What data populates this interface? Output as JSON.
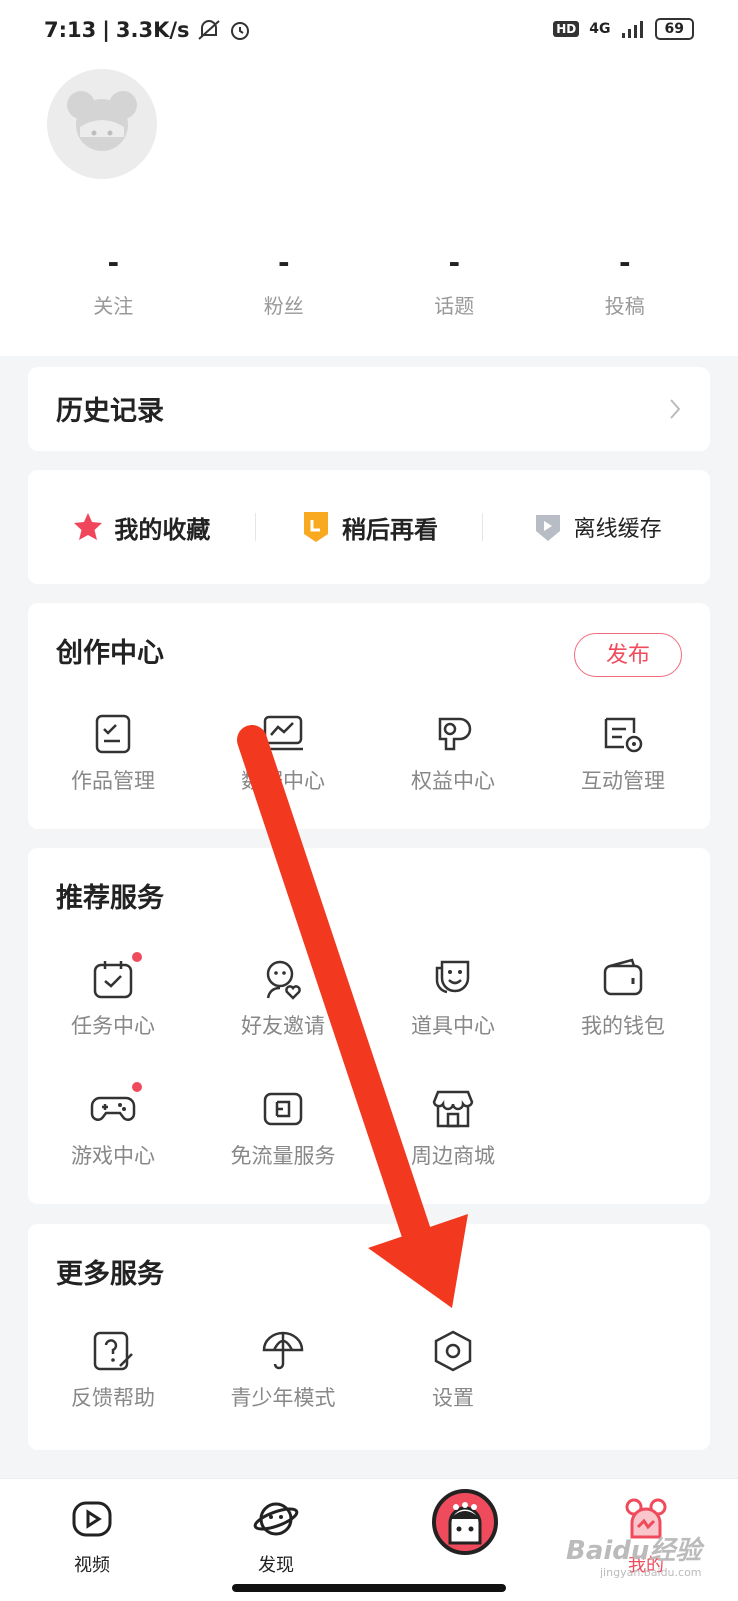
{
  "status": {
    "time": "7:13",
    "speed": "3.3K/s",
    "network": "4G",
    "hd": "HD",
    "battery": "69"
  },
  "profile": {
    "stats": [
      {
        "value": "-",
        "label": "关注"
      },
      {
        "value": "-",
        "label": "粉丝"
      },
      {
        "value": "-",
        "label": "话题"
      },
      {
        "value": "-",
        "label": "投稿"
      }
    ]
  },
  "history": {
    "title": "历史记录"
  },
  "quick": [
    {
      "label": "我的收藏",
      "icon": "star-icon"
    },
    {
      "label": "稍后再看",
      "icon": "watch-later-icon"
    },
    {
      "label": "离线缓存",
      "icon": "download-icon"
    }
  ],
  "creation": {
    "title": "创作中心",
    "publish_label": "发布",
    "items": [
      {
        "label": "作品管理",
        "icon": "works-icon"
      },
      {
        "label": "数据中心",
        "icon": "data-chart-icon"
      },
      {
        "label": "权益中心",
        "icon": "rights-icon"
      },
      {
        "label": "互动管理",
        "icon": "interaction-icon"
      }
    ]
  },
  "recommend": {
    "title": "推荐服务",
    "items": [
      {
        "label": "任务中心",
        "icon": "task-calendar-icon",
        "badge": true
      },
      {
        "label": "好友邀请",
        "icon": "invite-friend-icon",
        "badge": false
      },
      {
        "label": "道具中心",
        "icon": "mask-icon",
        "badge": false
      },
      {
        "label": "我的钱包",
        "icon": "wallet-icon",
        "badge": false
      },
      {
        "label": "游戏中心",
        "icon": "gamepad-icon",
        "badge": true
      },
      {
        "label": "免流量服务",
        "icon": "sim-card-icon",
        "badge": false
      },
      {
        "label": "周边商城",
        "icon": "store-icon",
        "badge": false
      }
    ]
  },
  "more": {
    "title": "更多服务",
    "items": [
      {
        "label": "反馈帮助",
        "icon": "help-icon"
      },
      {
        "label": "青少年模式",
        "icon": "umbrella-icon"
      },
      {
        "label": "设置",
        "icon": "settings-hex-icon"
      }
    ]
  },
  "tabs": [
    {
      "label": "视频",
      "icon": "video-icon"
    },
    {
      "label": "发现",
      "icon": "planet-icon"
    },
    {
      "label": "",
      "icon": "center-mascot-icon"
    },
    {
      "label": "我的",
      "icon": "mascot-me-icon"
    }
  ],
  "watermark": {
    "text": "Baidu经验",
    "sub": "jingyan.baidu.com"
  },
  "colors": {
    "accent": "#f04b5c",
    "arrow": "#f2391f",
    "star": "#f0455a",
    "later": "#f8a91f"
  }
}
